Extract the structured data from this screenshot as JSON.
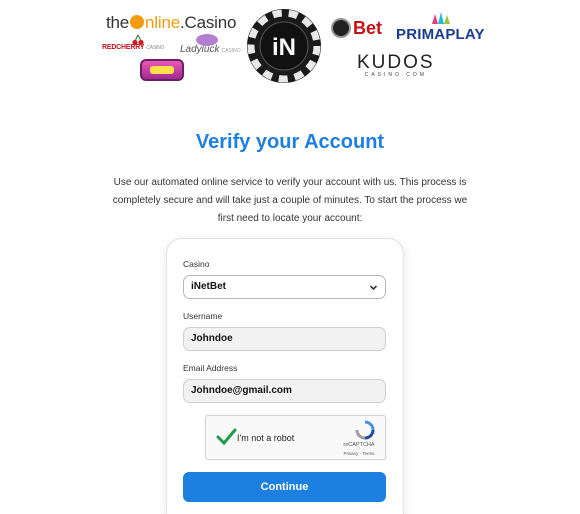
{
  "partners": {
    "online_casino": {
      "prefix": "the",
      "brand": "nline",
      "suffix": ".Casino"
    },
    "red_cherry": {
      "main": "REDCHERRY",
      "sub": "CASINO"
    },
    "lady_luck": {
      "main": "Ladyluck",
      "sub": "CASINO"
    },
    "chip_logo": "iN",
    "inetbet": "Bet",
    "primaplay": "PRIMAPLAY",
    "kudos": {
      "main": "KUDOS",
      "sub": "CASINO.COM"
    }
  },
  "page": {
    "title": "Verify your Account",
    "intro": "Use our automated online service to verify your account with us. This process is completely secure and will take just a couple of minutes. To start the process we first need to locate your account:"
  },
  "form": {
    "casino_label": "Casino",
    "casino_value": "iNetBet",
    "username_label": "Username",
    "username_value": "Johndoe",
    "email_label": "Email Address",
    "email_value": "Johndoe@gmail.com",
    "submit_label": "Continue"
  },
  "captcha": {
    "label": "I'm not a robot",
    "brand": "reCAPTCHA",
    "links": "Privacy - Terms",
    "checked": true
  },
  "colors": {
    "accent": "#1d7fe0",
    "check": "#1e9e4a"
  },
  "icons": [
    "cherry-icon",
    "chip-icon",
    "checkmark-icon",
    "recaptcha-icon",
    "chevron-down-icon"
  ]
}
